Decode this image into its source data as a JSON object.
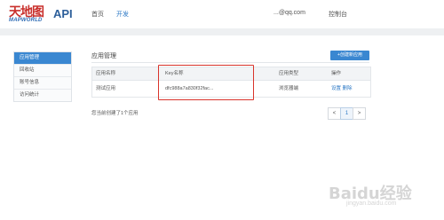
{
  "header": {
    "logo_cn": "天地图",
    "logo_en": "MAPWORLD",
    "logo_api": "API",
    "nav": {
      "home": "首页",
      "dev": "开发",
      "email": "...@qq.com",
      "console": "控制台"
    }
  },
  "sidebar": {
    "items": [
      {
        "label": "应用管理",
        "active": true
      },
      {
        "label": "回收站",
        "active": false
      },
      {
        "label": "账号信息",
        "active": false
      },
      {
        "label": "访问统计",
        "active": false
      }
    ]
  },
  "main": {
    "title": "应用管理",
    "create_button": "+创建新应用",
    "table": {
      "headers": [
        "应用名称",
        "Key名称",
        "应用类型",
        "操作"
      ],
      "rows": [
        {
          "name": "测试应用",
          "key": "dfc988a7a830f32fac...",
          "type": "浏览器端",
          "op1": "设置",
          "op2": "删除"
        }
      ]
    },
    "footer_text": "您当前创建了1个应用",
    "pagination": {
      "prev": "<",
      "current": "1",
      "next": ">"
    }
  },
  "watermark": {
    "text": "Baidu经验",
    "sub": "jingyan.baidu.com"
  }
}
